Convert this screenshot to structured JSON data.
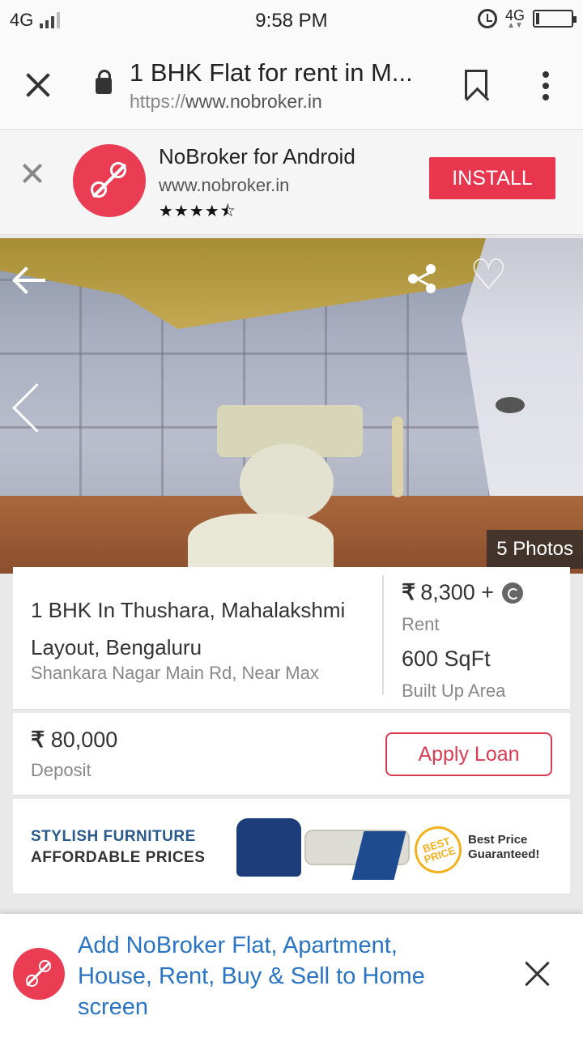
{
  "status_bar": {
    "network_left": "4G",
    "time": "9:58 PM",
    "network_right": "4G"
  },
  "browser": {
    "page_title": "1 BHK Flat for rent in M...",
    "url_protocol": "https://",
    "url_host": "www.nobroker.in"
  },
  "app_banner": {
    "app_name": "NoBroker for Android",
    "app_url": "www.nobroker.in",
    "rating_stars": "★★★★⯪",
    "install_label": "INSTALL"
  },
  "gallery": {
    "photo_count_label": "5 Photos"
  },
  "listing": {
    "title": "1 BHK In Thushara, Mahalakshmi Layout, Bengaluru",
    "address": "Shankara Nagar Main Rd, Near Max",
    "rent_value": "8,300 +",
    "rent_label": "Rent",
    "area_value": "600 SqFt",
    "area_label": "Built Up Area",
    "currency_symbol": "₹",
    "deposit_value": "80,000",
    "deposit_label": "Deposit",
    "apply_loan_label": "Apply Loan"
  },
  "ad": {
    "line1": "STYLISH FURNITURE",
    "line2": "AFFORDABLE PRICES",
    "badge_text": "BEST PRICE",
    "tagline": "Best Price Guaranteed!"
  },
  "add_to_home": {
    "text": "Add NoBroker Flat, Apartment, House, Rent, Buy & Sell to Home screen"
  },
  "colors": {
    "brand_red": "#ea3c53",
    "link_blue": "#2a74c4"
  }
}
